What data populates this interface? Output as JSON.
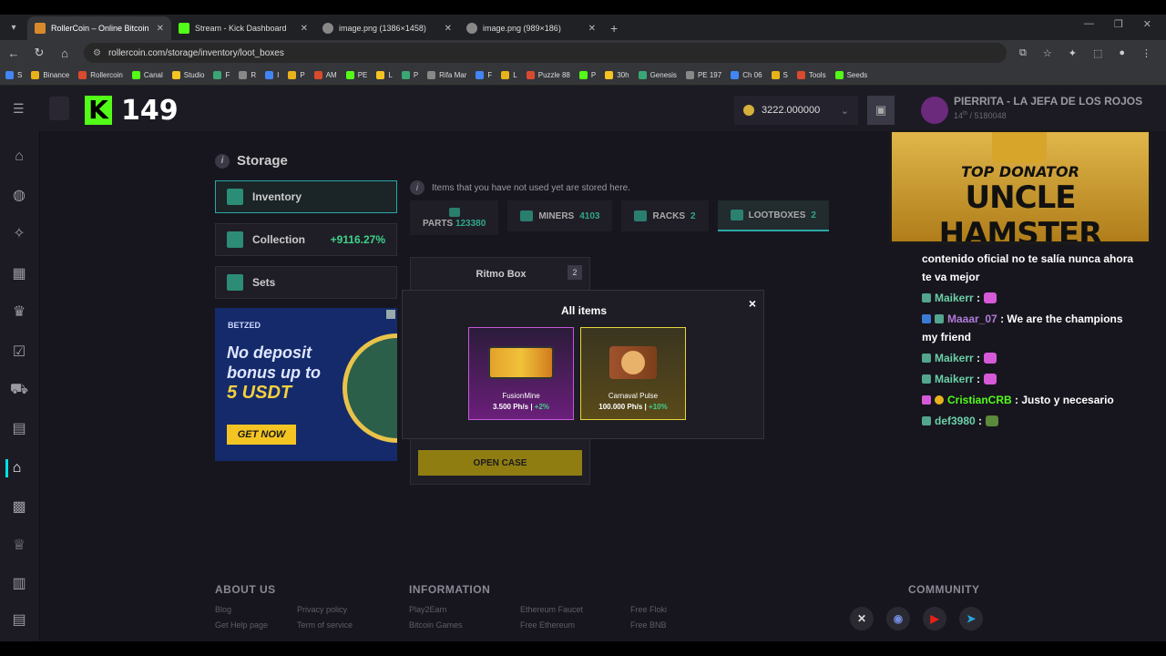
{
  "browser": {
    "tabs": [
      {
        "title": "RollerCoin – Online Bitcoin Mini",
        "active": true,
        "color": "#d98b2b"
      },
      {
        "title": "Stream - Kick Dashboard",
        "active": false,
        "color": "#53fc18"
      },
      {
        "title": "image.png (1386×1458)",
        "active": false,
        "color": "#888888"
      },
      {
        "title": "image.png (989×186)",
        "active": false,
        "color": "#888888"
      }
    ],
    "url": "rollercoin.com/storage/inventory/loot_boxes",
    "bookmarks": [
      "S",
      "Binance",
      "Rollercoin",
      "Canal",
      "Studio",
      "F",
      "R",
      "I",
      "P",
      "AM",
      "PE",
      "L",
      "P",
      "Rifa Mar",
      "F",
      "L",
      "Puzzle 88",
      "P",
      "30h",
      "Genesis",
      "PE 197",
      "Ch 06",
      "S",
      "Tools",
      "Seeds"
    ]
  },
  "header": {
    "kick_letter": "K",
    "kick_count": "149",
    "balance": "3222.000000",
    "username": "PIERRITA - LA JEFA DE LOS ROJOS",
    "level": "14",
    "level_sup": "th",
    "rank": "/ 5180048"
  },
  "storage": {
    "title": "Storage",
    "menu": [
      {
        "label": "Inventory",
        "extra": ""
      },
      {
        "label": "Collection",
        "extra": "+9116.27%"
      },
      {
        "label": "Sets",
        "extra": ""
      }
    ],
    "notice": "Items that you have not used yet are stored here.",
    "tabs": [
      {
        "label": "PARTS",
        "count": "123380"
      },
      {
        "label": "MINERS",
        "count": "4103"
      },
      {
        "label": "RACKS",
        "count": "2"
      },
      {
        "label": "LOOTBOXES",
        "count": "2"
      }
    ],
    "card": {
      "name": "Ritmo Box",
      "count": "2",
      "button": "OPEN CASE"
    }
  },
  "ad": {
    "brand": "BETZED",
    "headline": "No deposit bonus up to",
    "amount": "5 USDT",
    "cta": "GET NOW"
  },
  "modal": {
    "title": "All items",
    "close": "×",
    "items": [
      {
        "name": "FusionMine",
        "power": "3.500 Ph/s",
        "bonus": "+2%"
      },
      {
        "name": "Carnaval Pulse",
        "power": "100.000 Ph/s",
        "bonus": "+10%"
      }
    ]
  },
  "overlay": {
    "donor_line1": "TOP DONATOR",
    "donor_line2": "UNCLE HAMSTER"
  },
  "chat": [
    {
      "user": "",
      "text": "contenido oficial no te salía nunca ahora te va mejor",
      "color": "#ffffff"
    },
    {
      "user": "Maikerr",
      "text": ":",
      "color": "#6bd0a6"
    },
    {
      "user": "Maaar_07",
      "text": ": We are the champions my friend",
      "color": "#b07bd6"
    },
    {
      "user": "Maikerr",
      "text": ":",
      "color": "#6bd0a6"
    },
    {
      "user": "Maikerr",
      "text": ":",
      "color": "#6bd0a6"
    },
    {
      "user": "CristianCRB",
      "text": ": Justo y necesario",
      "color": "#53fc18"
    },
    {
      "user": "def3980",
      "text": ":",
      "color": "#6bd0a6"
    }
  ],
  "footer": {
    "about_title": "ABOUT US",
    "about_links": [
      "Blog",
      "Get Help page",
      "Privacy policy",
      "Term of service"
    ],
    "info_title": "INFORMATION",
    "info_links": [
      "Play2Earn",
      "Bitcoin Games",
      "Ethereum Faucet",
      "Free Ethereum",
      "Free Floki",
      "Free BNB"
    ],
    "community_title": "COMMUNITY"
  }
}
